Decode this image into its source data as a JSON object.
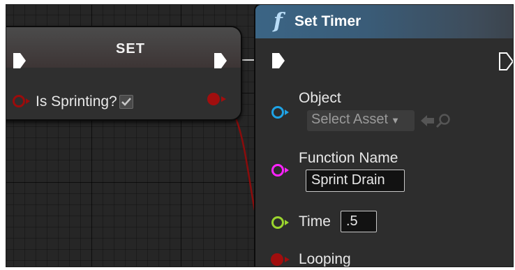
{
  "set_node": {
    "title": "SET",
    "variable_label": "Is Sprinting?",
    "checkbox_checked": true
  },
  "timer_node": {
    "title": "Set Timer",
    "function_glyph": "f",
    "object": {
      "label": "Object",
      "select_value": "Select Asset"
    },
    "function_name": {
      "label": "Function Name",
      "value": "Sprint Drain"
    },
    "time": {
      "label": "Time",
      "value": ".5"
    },
    "looping": {
      "label": "Looping"
    }
  },
  "colors": {
    "exec_pin": "#ffffff",
    "bool_pin": "#9b0b0b",
    "object_pin": "#1ea3e6",
    "string_pin": "#ff22ff",
    "float_pin": "#9bd52e",
    "wire_bool": "#8a0c0c",
    "wire_exec": "#e6e6e6"
  },
  "icons": [
    "exec-pin-icon",
    "bool-pin-icon",
    "object-pin-icon",
    "string-pin-icon",
    "float-pin-icon",
    "checkmark-icon",
    "caret-down-icon",
    "arrow-left-icon",
    "magnifier-icon",
    "function-icon"
  ]
}
